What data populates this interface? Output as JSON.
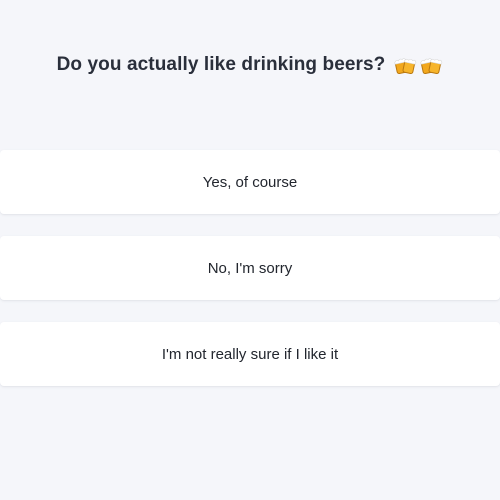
{
  "question": {
    "text": "Do you actually like drinking beers?",
    "emojis": [
      "beers-icon",
      "beers-icon"
    ]
  },
  "options": [
    {
      "label": "Yes, of course"
    },
    {
      "label": "No, I'm sorry"
    },
    {
      "label": "I'm not really sure if I like it"
    }
  ],
  "colors": {
    "background": "#f5f6fa",
    "card": "#ffffff",
    "title": "#2a2f3b",
    "text": "#22262e",
    "beer": "#f2a81d"
  }
}
